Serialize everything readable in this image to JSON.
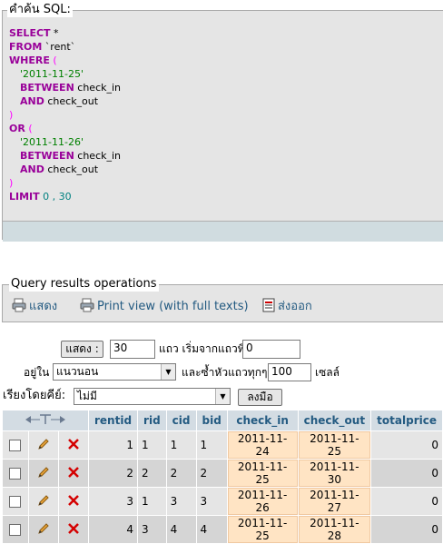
{
  "sql_box": {
    "legend": "คำค้น SQL:",
    "lines": [
      {
        "k": "SELECT",
        "rest": " *"
      },
      {
        "k": "FROM",
        "rest": " `rent`"
      },
      {
        "k": "WHERE",
        "rest": " ("
      },
      {
        "str": "'2011-11-25'"
      },
      {
        "k": "BETWEEN",
        "rest": " check_in"
      },
      {
        "k": "AND",
        "rest": " check_out"
      },
      {
        "pu": ")"
      },
      {
        "k": "OR",
        "rest": " ("
      },
      {
        "str": "'2011-11-26'"
      },
      {
        "k": "BETWEEN",
        "rest": " check_in"
      },
      {
        "k": "AND",
        "rest": " check_out"
      },
      {
        "pu": ")"
      },
      {
        "k": "LIMIT",
        "num": " 0 , 30"
      }
    ]
  },
  "operations": {
    "legend": "Query results operations",
    "print_label": "แสดง",
    "print_view_label": "Print view (with full texts)",
    "export_label": "ส่งออก"
  },
  "navigation": {
    "show_button": "แสดง :",
    "rows_value": "30",
    "rows_from_label": "แถว เริ่มจากแถวที่",
    "start_value": "0",
    "mode_label": "อยู่ใน",
    "mode_value": "แนวนอน",
    "repeat_label": "และซ้ำหัวแถวทุกๆ",
    "repeat_value": "100",
    "cells_label": "เซลล์",
    "sort_label": "เรียงโดยคีย์:",
    "sort_value": "ไม่มี",
    "go_button": "ลงมือ"
  },
  "table": {
    "columns": [
      "rentid",
      "rid",
      "cid",
      "bid",
      "check_in",
      "check_out",
      "totalprice"
    ],
    "rows": [
      [
        "1",
        "1",
        "1",
        "1",
        "2011-11-24",
        "2011-11-25",
        "0"
      ],
      [
        "2",
        "2",
        "2",
        "2",
        "2011-11-25",
        "2011-11-30",
        "0"
      ],
      [
        "3",
        "1",
        "3",
        "3",
        "2011-11-26",
        "2011-11-27",
        "0"
      ],
      [
        "4",
        "3",
        "4",
        "4",
        "2011-11-25",
        "2011-11-28",
        "0"
      ]
    ]
  },
  "colors": {
    "header_bg": "#d3dce3",
    "header_text": "#235a81",
    "keyword": "#990099",
    "string": "#008000",
    "date_highlight": "#ffe4c4"
  },
  "icons": [
    "sort-arrows-icon",
    "edit-pencil-icon",
    "delete-x-icon",
    "print-icon",
    "print-view-icon",
    "export-icon"
  ]
}
